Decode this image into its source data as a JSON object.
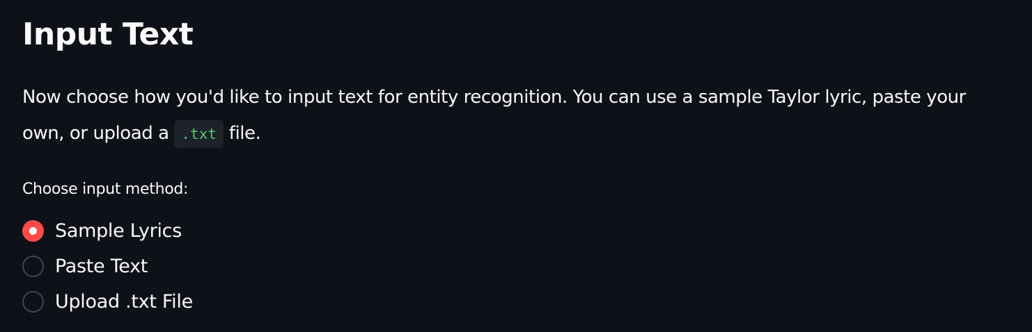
{
  "title": "Input Text",
  "intro": {
    "part1": "Now choose how you'd like to input text for entity recognition. You can use a sample Taylor lyric, paste your own, or upload a ",
    "code": ".txt",
    "part2": " file."
  },
  "input_method": {
    "label": "Choose input method:",
    "selected": "Sample Lyrics",
    "options": [
      {
        "label": "Sample Lyrics",
        "checked": true
      },
      {
        "label": "Paste Text",
        "checked": false
      },
      {
        "label": "Upload .txt File",
        "checked": false
      }
    ]
  },
  "colors": {
    "background": "#0e1117",
    "text": "#fafafa",
    "accent": "#ff4b4b",
    "code_text": "#5ac46f",
    "code_background": "#1d2129",
    "radio_border": "#414451"
  }
}
